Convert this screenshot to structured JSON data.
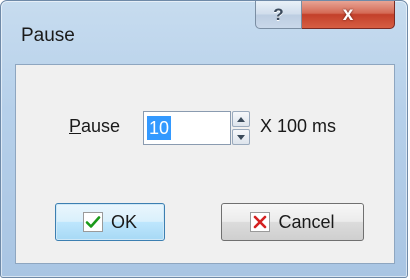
{
  "window": {
    "title": "Pause",
    "help_glyph": "?",
    "close_glyph": "x"
  },
  "form": {
    "label_first": "P",
    "label_rest": "ause",
    "value": "10",
    "unit": "X 100 ms"
  },
  "buttons": {
    "ok": "OK",
    "cancel": "Cancel"
  },
  "colors": {
    "ok_check": "#1a9a1a",
    "cancel_x": "#d42020",
    "selection": "#3399ff"
  }
}
